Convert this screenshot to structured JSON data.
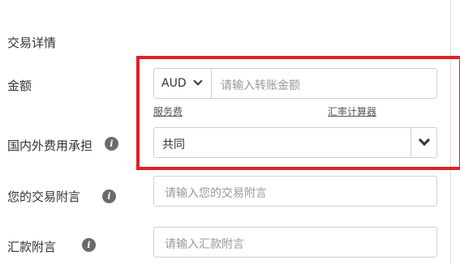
{
  "section": {
    "title": "交易详情"
  },
  "amount": {
    "label": "金额",
    "currency": "AUD",
    "placeholder": "请输入转账金额",
    "fee_link": "服务费",
    "calculator_link": "汇率计算器"
  },
  "domestic_fee": {
    "label": "国内外费用承担",
    "selected": "共同"
  },
  "transaction_note": {
    "label": "您的交易附言",
    "placeholder": "请输入您的交易附言"
  },
  "remittance_note": {
    "label": "汇款附言",
    "placeholder": "请输入汇款附言"
  },
  "icons": {
    "info": "i",
    "highlight_color": "#e0202a"
  }
}
